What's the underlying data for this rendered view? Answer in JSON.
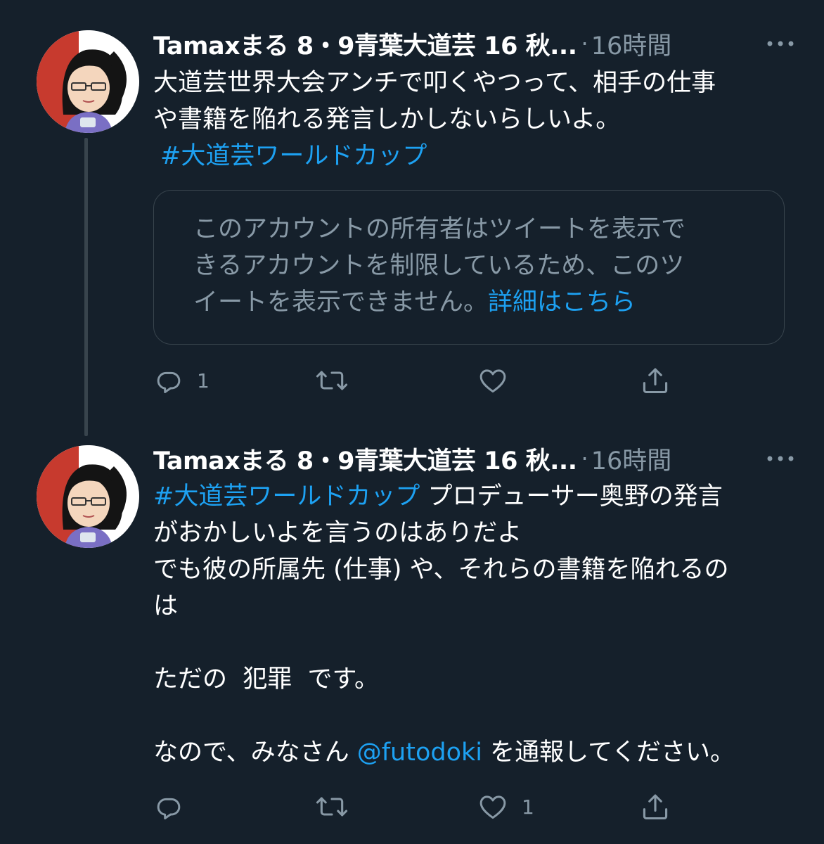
{
  "tweets": [
    {
      "author": {
        "display_name": "Tamaxまる 8・9青葉大道芸 16 秋..."
      },
      "separator": "·",
      "time": "16時間",
      "text_lines": [
        "大道芸世界大会アンチで叩くやつって、相手の仕事",
        "や書籍を陥れる発言しかしないらしいよ。",
        "#大道芸ワールドカップ"
      ],
      "quote_notice": {
        "lines": [
          "このアカウントの所有者はツイートを表示で",
          "きるアカウントを制限しているため、このツ",
          "イートを表示できません。"
        ],
        "link_text": "詳細はこちら"
      },
      "actions": {
        "reply_count": "1",
        "retweet_count": "",
        "like_count": ""
      }
    },
    {
      "author": {
        "display_name": "Tamaxまる 8・9青葉大道芸 16 秋..."
      },
      "separator": "·",
      "time": "16時間",
      "text": {
        "hashtag": "#大道芸ワールドカップ",
        "line1_rest": " プロデューサー奥野の発言",
        "line2": "がおかしいよを言うのはありだよ",
        "line3": "でも彼の所属先 (仕事) や、それらの書籍を陥れるの",
        "line4": "は",
        "line6": "ただの  犯罪  です。",
        "line8_before": "なので、みなさん ",
        "mention": "@futodoki",
        "line8_after": " を通報してください。"
      },
      "actions": {
        "reply_count": "",
        "retweet_count": "",
        "like_count": "1"
      }
    }
  ],
  "icons": [
    "reply-icon",
    "retweet-icon",
    "like-icon",
    "share-icon",
    "more-icon"
  ],
  "colors": {
    "background": "#15202b",
    "text": "#ffffff",
    "secondary": "#8899a6",
    "link": "#1da1f2",
    "border": "#38444d"
  }
}
